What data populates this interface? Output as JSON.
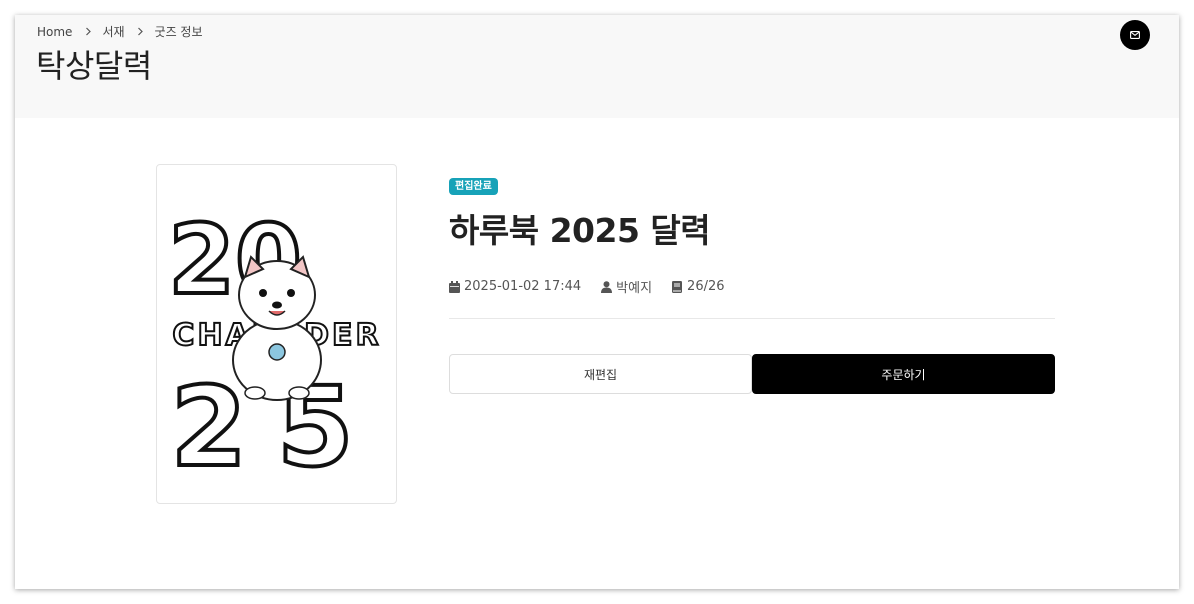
{
  "breadcrumb": {
    "home": "Home",
    "library": "서재",
    "current": "굿즈 정보"
  },
  "page": {
    "title": "탁상달력"
  },
  "header": {
    "mail_icon": "mail-icon"
  },
  "product": {
    "status": "편집완료",
    "title": "하루북 2025 달력",
    "date": "2025-01-02 17:44",
    "author": "박예지",
    "pages": "26/26",
    "cover_text": {
      "top": "20",
      "middle": "CHARADER",
      "bottom": "25"
    }
  },
  "actions": {
    "reedit": "재편집",
    "order": "주문하기"
  },
  "colors": {
    "badge": "#17a2b8",
    "primary_button": "#000000",
    "header_bg": "#f8f8f8"
  }
}
